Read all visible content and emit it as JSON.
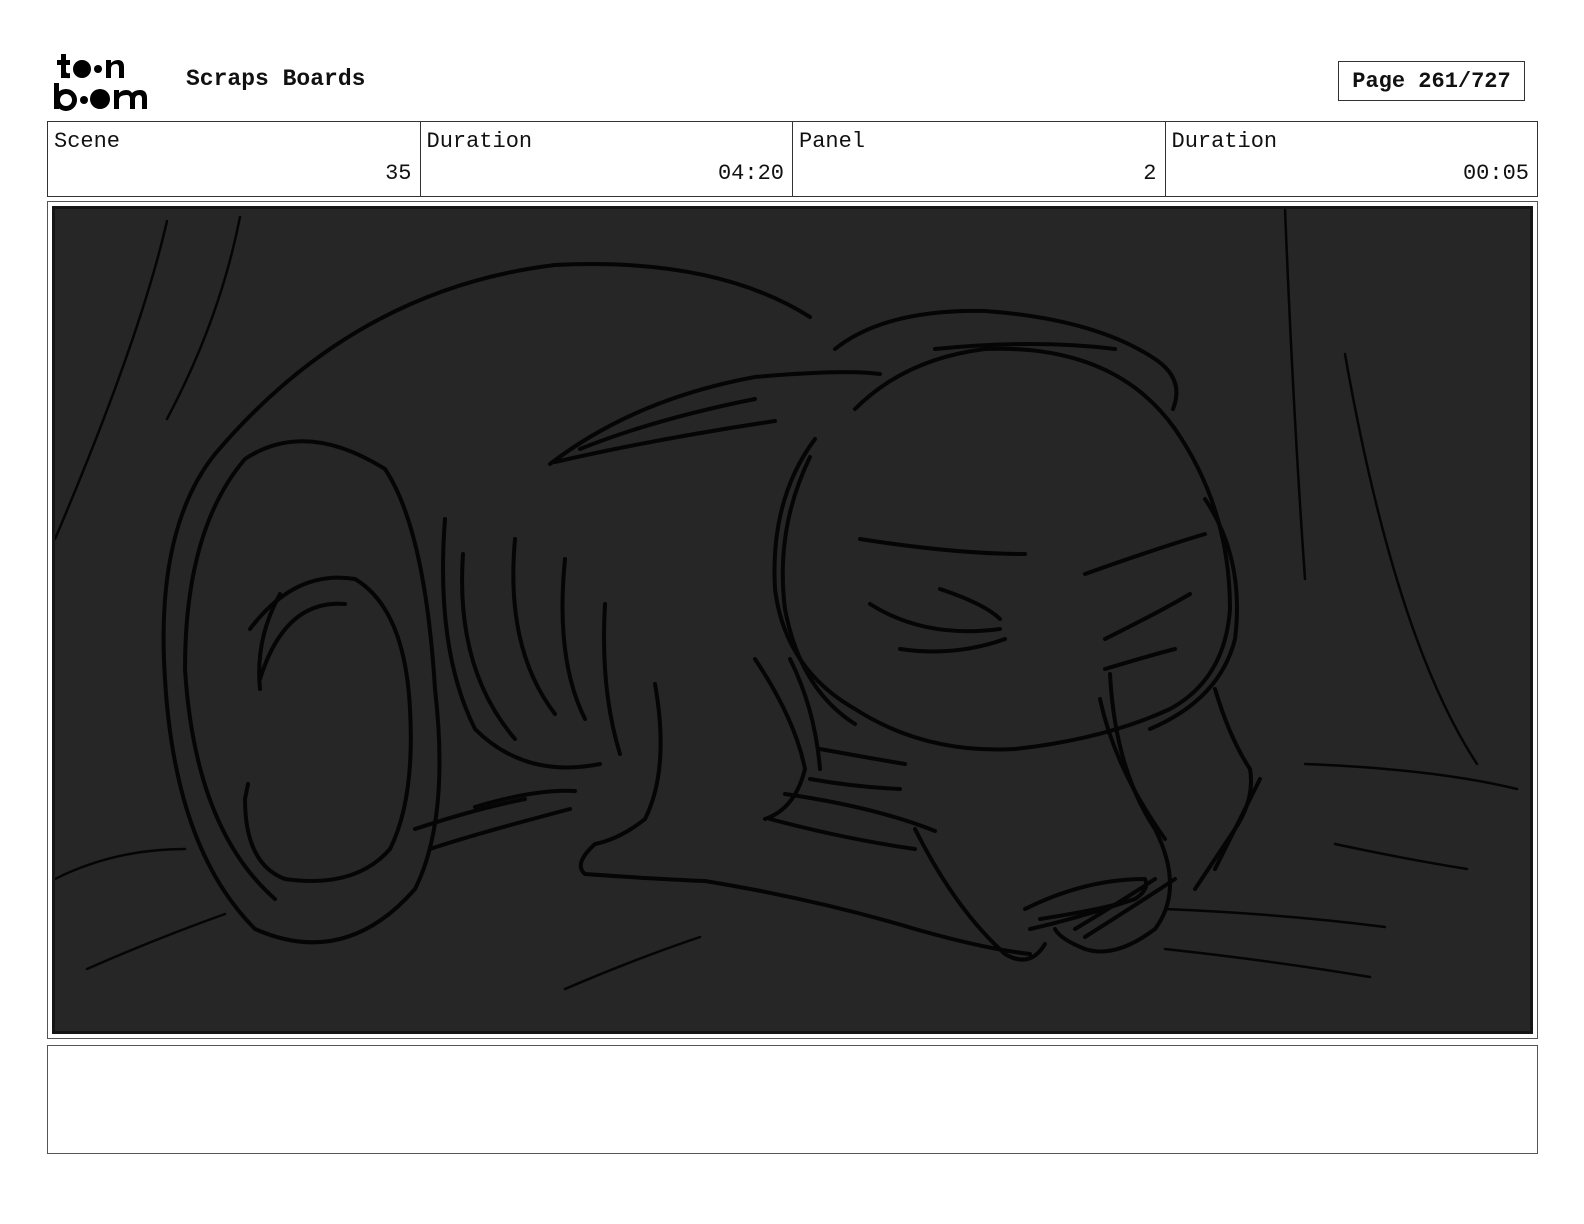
{
  "header": {
    "logo_text": "toonboom",
    "title": "Scraps Boards",
    "page_label": "Page 261/727"
  },
  "info": {
    "scene_label": "Scene",
    "scene_value": "35",
    "scene_duration_label": "Duration",
    "scene_duration_value": "04:20",
    "panel_label": "Panel",
    "panel_value": "2",
    "panel_duration_label": "Duration",
    "panel_duration_value": "00:05"
  },
  "notes": {
    "text": ""
  },
  "colors": {
    "panel_background": "#262626",
    "sketch_stroke": "#050505"
  }
}
